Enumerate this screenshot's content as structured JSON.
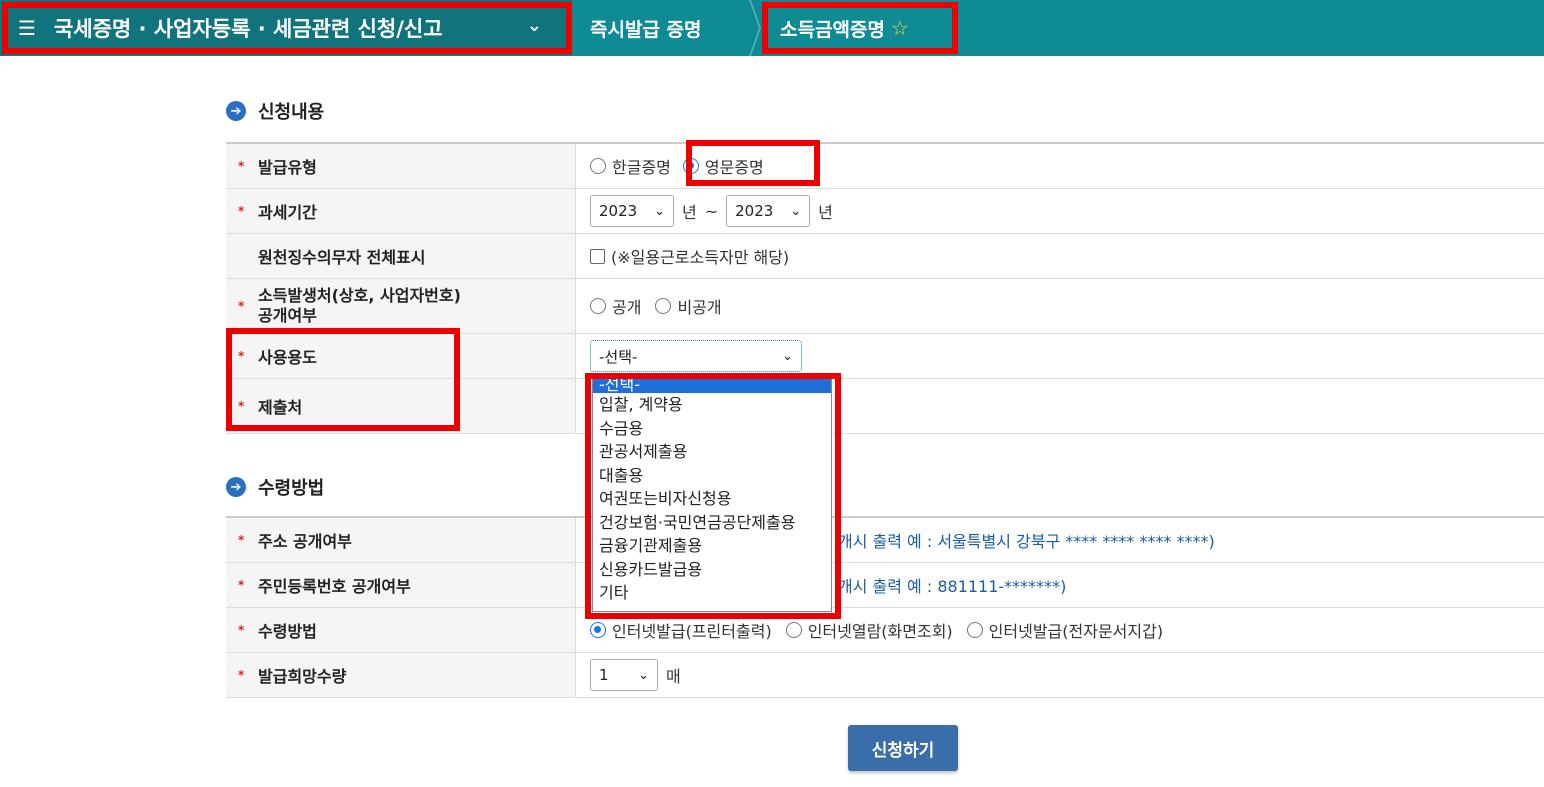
{
  "topbar": {
    "menu_title": "국세증명 · 사업자등록 · 세금관련 신청/신고",
    "breadcrumb_1": "즉시발급 증명",
    "breadcrumb_2": "소득금액증명"
  },
  "section1": {
    "title": "신청내용",
    "rows": {
      "issue_type": {
        "label": "발급유형",
        "opt1": "한글증명",
        "opt2": "영문증명",
        "selected": "영문증명"
      },
      "tax_period": {
        "label": "과세기간",
        "from": "2023",
        "unit1": "년",
        "tilde": "~",
        "to": "2023",
        "unit2": "년"
      },
      "withholding": {
        "label": "원천징수의무자 전체표시",
        "note": "(※일용근로소득자만 해당)"
      },
      "income_source": {
        "label_line1": "소득발생처(상호, 사업자번호)",
        "label_line2": "공개여부",
        "opt1": "공개",
        "opt2": "비공개"
      },
      "usage": {
        "label": "사용용도",
        "value": "-선택-"
      },
      "submit_to": {
        "label": "제출처"
      }
    }
  },
  "dropdown": {
    "options": [
      "-선택-",
      "입찰, 계약용",
      "수금용",
      "관공서제출용",
      "대출용",
      "여권또는비자신청용",
      "건강보험·국민연금공단제출용",
      "금융기관제출용",
      "신용카드발급용",
      "기타"
    ]
  },
  "section2": {
    "title": "수령방법",
    "rows": {
      "address": {
        "label": "주소 공개여부",
        "example": "개시 출력 예 : 서울특별시 강북구 **** **** **** ****)"
      },
      "rrn": {
        "label": "주민등록번호 공개여부",
        "example": "개시 출력 예 : 881111-*******)"
      },
      "receive": {
        "label": "수령방법",
        "opt1": "인터넷발급(프린터출력)",
        "opt2": "인터넷열람(화면조회)",
        "opt3": "인터넷발급(전자문서지갑)"
      },
      "qty": {
        "label": "발급희망수량",
        "value": "1",
        "unit": "매"
      }
    }
  },
  "submit_label": "신청하기",
  "accent_color": "#0e8b94",
  "highlight_color": "#e00000"
}
